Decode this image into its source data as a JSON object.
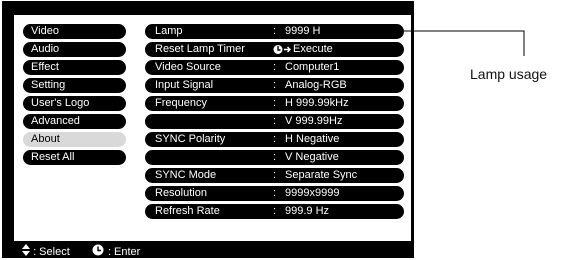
{
  "menu": {
    "items": [
      {
        "label": "Video"
      },
      {
        "label": "Audio"
      },
      {
        "label": "Effect"
      },
      {
        "label": "Setting"
      },
      {
        "label": "User's Logo"
      },
      {
        "label": "Advanced"
      },
      {
        "label": "About"
      },
      {
        "label": "Reset All"
      }
    ],
    "selected": "About"
  },
  "details": {
    "rows": [
      {
        "label": "Lamp",
        "value": "9999 H"
      },
      {
        "label": "Reset Lamp Timer",
        "value": "Execute"
      },
      {
        "label": "Video Source",
        "value": "Computer1"
      },
      {
        "label": "Input Signal",
        "value": "Analog-RGB"
      },
      {
        "label": "Frequency",
        "value": "H  999.99kHz"
      },
      {
        "label": "",
        "value": "V  999.99Hz"
      },
      {
        "label": "SYNC Polarity",
        "value": "H  Negative"
      },
      {
        "label": "",
        "value": "V  Negative"
      },
      {
        "label": "SYNC Mode",
        "value": "Separate Sync"
      },
      {
        "label": "Resolution",
        "value": "9999x9999"
      },
      {
        "label": "Refresh Rate",
        "value": " 999.9 Hz"
      }
    ],
    "colon": ":"
  },
  "footer": {
    "select_text": ": Select",
    "enter_text": ": Enter"
  },
  "callout": {
    "label": "Lamp usage"
  },
  "icons": {
    "select": "up-down-arrows-icon",
    "enter": "enter-button-icon"
  },
  "colors": {
    "screen_bg": "#000000",
    "panel_bg": "#ffffff",
    "selected_item": "#d9d9d9"
  }
}
